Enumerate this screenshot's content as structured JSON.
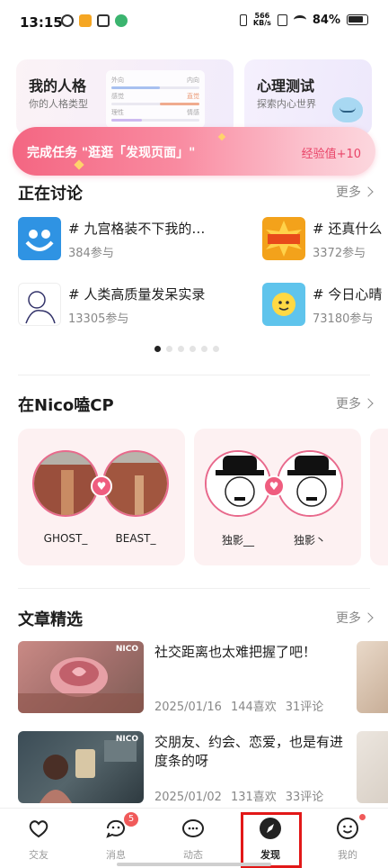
{
  "status_bar": {
    "time": "13:15",
    "net_speed_top": "566",
    "net_speed_unit": "KB/s",
    "battery": "84%"
  },
  "cards": {
    "persona": {
      "title": "我的人格",
      "subtitle": "你的人格类型",
      "graph": [
        {
          "left": "外向",
          "right": "内向"
        },
        {
          "left": "感觉",
          "right": "直觉"
        },
        {
          "left": "理性",
          "right": "情感"
        }
      ]
    },
    "test": {
      "title": "心理测试",
      "subtitle": "探索内心世界"
    }
  },
  "task": {
    "label": "完成任务 \"逛逛「发现页面」\"",
    "reward": "经验值+10"
  },
  "discussion": {
    "title": "正在讨论",
    "more": "更多",
    "topics": [
      {
        "title": "#  九宫格装不下我的…",
        "count": "384参与"
      },
      {
        "title": "#  还真什么",
        "count": "3372参与"
      },
      {
        "title": "#  人类高质量发呆实录",
        "count": "13305参与"
      },
      {
        "title": "#  今日心晴",
        "count": "73180参与"
      }
    ]
  },
  "cp": {
    "title": "在Nico嗑CP",
    "more": "更多",
    "pairs": [
      {
        "left": "GHOST_",
        "right": "BEAST_"
      },
      {
        "left": "独影__",
        "right": "独影丶"
      }
    ]
  },
  "articles": {
    "title": "文章精选",
    "more": "更多",
    "items": [
      {
        "title": "社交距离也太难把握了吧！",
        "date": "2025/01/16",
        "likes": "144喜欢",
        "comments": "31评论",
        "logo": "NICO"
      },
      {
        "title": "交朋友、约会、恋爱，也是有进度条的呀",
        "date": "2025/01/02",
        "likes": "131喜欢",
        "comments": "33评论",
        "logo": "NICO"
      }
    ]
  },
  "tabs": [
    {
      "label": "交友"
    },
    {
      "label": "消息",
      "badge": "5"
    },
    {
      "label": "动态"
    },
    {
      "label": "发现"
    },
    {
      "label": "我的"
    }
  ]
}
